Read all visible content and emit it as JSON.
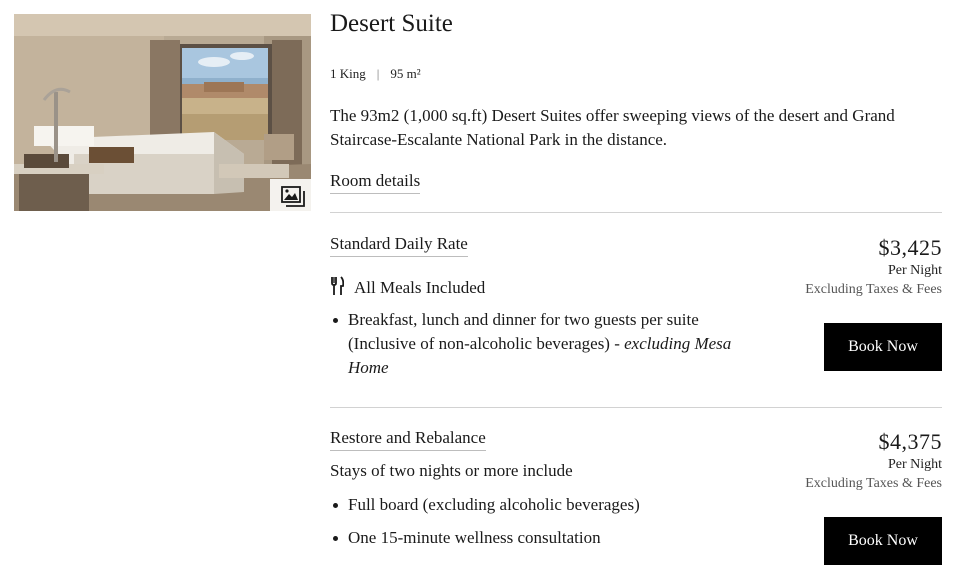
{
  "room": {
    "title": "Desert Suite",
    "beds": "1 King",
    "separator": "|",
    "size": "95 m²",
    "description": "The 93m2 (1,000 sq.ft) Desert Suites offer sweeping views of the desert and Grand Staircase-Escalante National Park in the distance.",
    "details_link": "Room details",
    "image_icon": "gallery-icon"
  },
  "rates": [
    {
      "name": "Standard Daily Rate",
      "subtitle_icon": "fork-knife-icon",
      "subtitle": "All Meals Included",
      "bullets": [
        {
          "text": "Breakfast, lunch and dinner for two guests per suite  (Inclusive of non-alcoholic beverages) - ",
          "emphasis": "excluding Mesa Home"
        }
      ],
      "price": "$3,425",
      "per_night": "Per Night",
      "taxes_note": "Excluding Taxes & Fees",
      "book_label": "Book Now"
    },
    {
      "name": "Restore and Rebalance",
      "subtitle": "Stays of two nights or more include",
      "bullets": [
        {
          "text": "Full board (excluding alcoholic beverages)"
        },
        {
          "text": "One 15-minute wellness consultation"
        }
      ],
      "price": "$4,375",
      "per_night": "Per Night",
      "taxes_note": "Excluding Taxes & Fees",
      "book_label": "Book Now"
    }
  ],
  "colors": {
    "button_bg": "#000000",
    "button_text": "#ffffff",
    "divider": "#d2d2d2"
  }
}
